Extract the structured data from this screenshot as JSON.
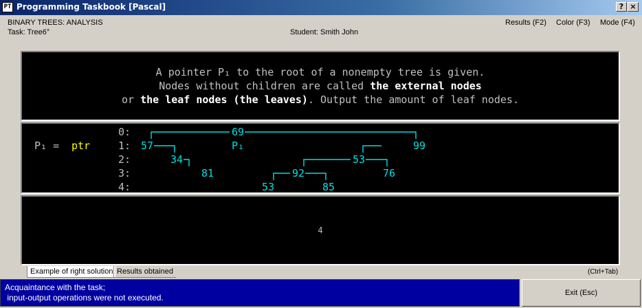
{
  "window": {
    "title": "Programming Taskbook [Pascal]",
    "icon_label": "PT",
    "help_label": "?",
    "close_label": "×"
  },
  "header": {
    "group": "BINARY TREES: ANALYSIS",
    "task": "Task: Tree6°",
    "student": "Student: Smith John",
    "menu": [
      "Results (F2)",
      "Color (F3)",
      "Mode (F4)"
    ]
  },
  "formulation": {
    "line1": "A pointer P₁ to the root of a nonempty tree is given.",
    "line2_plain": "Nodes without children are called ",
    "line2_bold": "the external nodes",
    "line3_plain1": "or ",
    "line3_bold": "the leaf nodes (the leaves)",
    "line3_plain2": ". Output the amount of leaf nodes."
  },
  "input": {
    "var_label": "P₁ = ",
    "var_value": "ptr",
    "pointer_label": "P₁",
    "level_labels": [
      "0:",
      "1:",
      "2:",
      "3:",
      "4:"
    ],
    "nodes": [
      "69",
      "57",
      "99",
      "34",
      "53",
      "81",
      "92",
      "76",
      "53",
      "85"
    ]
  },
  "result": {
    "value": "4"
  },
  "tabs": [
    "Example of right solution",
    "Results obtained"
  ],
  "ctrl_tab": "(Ctrl+Tab)",
  "status": {
    "line1": "Acquaintance with the task;",
    "line2": " input-output operations were not executed."
  },
  "exit_label": "Exit (Esc)",
  "colors": {
    "tree": "#00e0e0",
    "var": "#ffff00",
    "title_bar": "#0a246a",
    "status_bar": "#0000a0"
  }
}
